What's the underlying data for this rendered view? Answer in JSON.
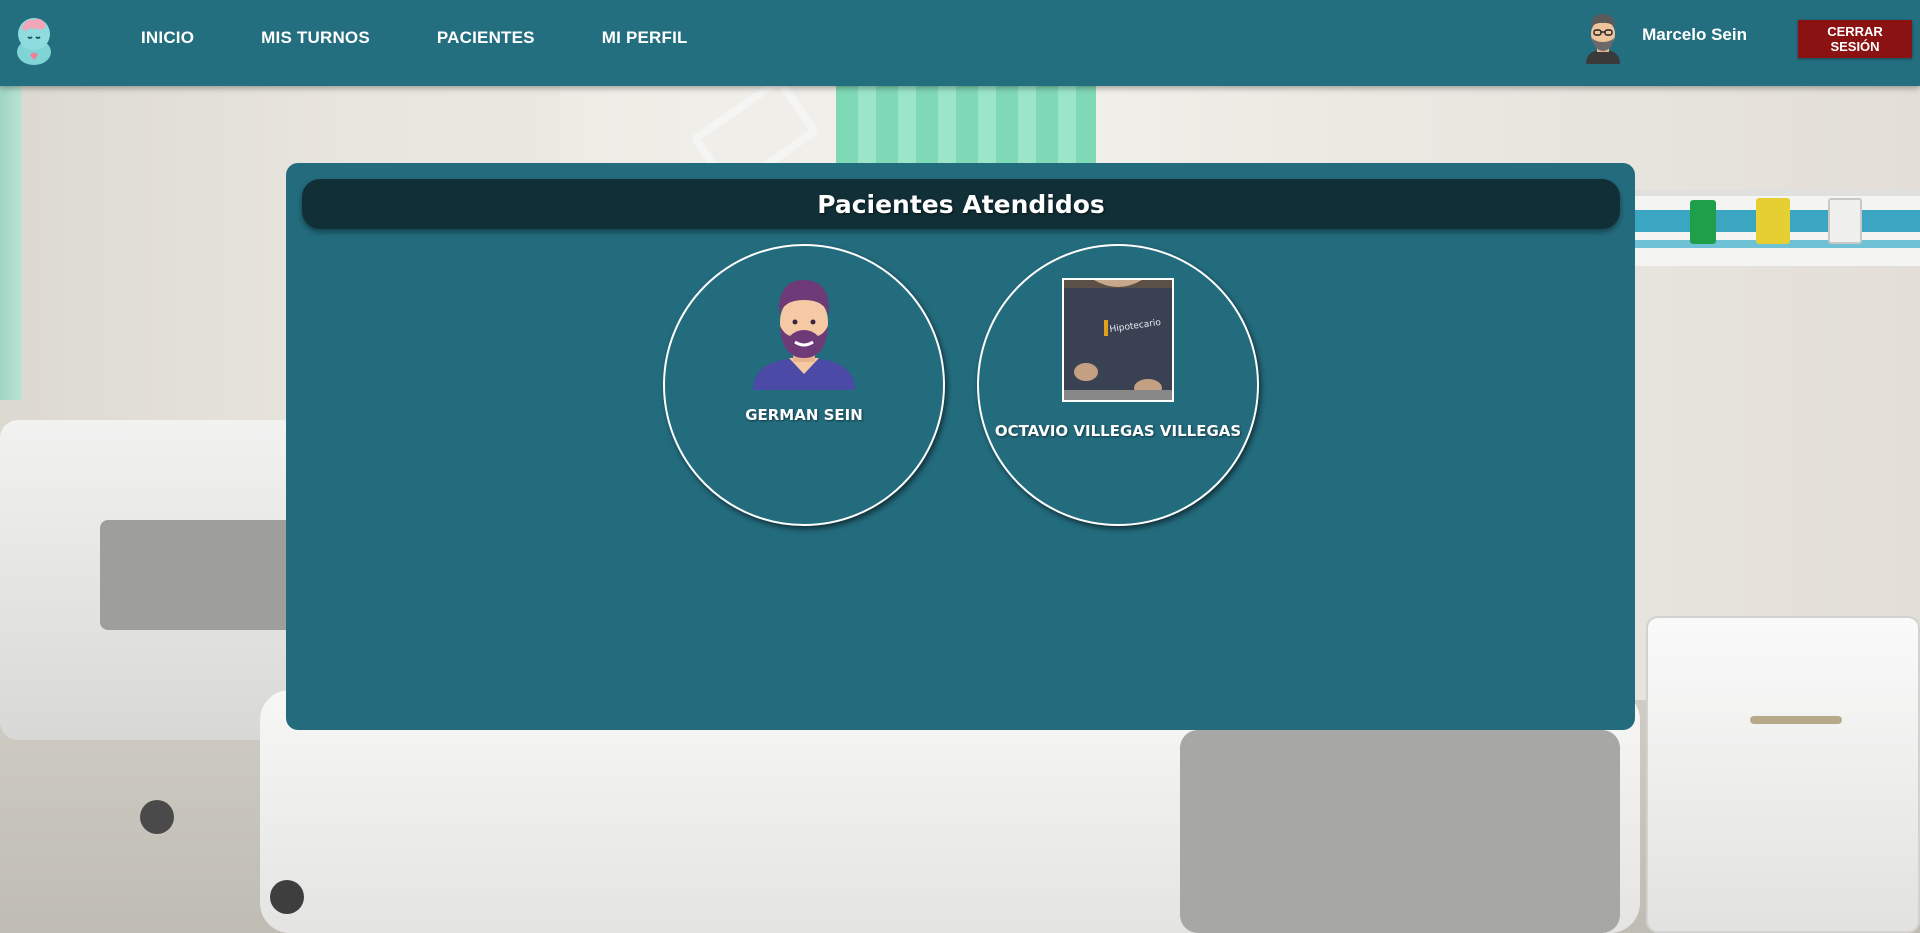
{
  "nav": {
    "links": [
      "INICIO",
      "MIS TURNOS",
      "PACIENTES",
      "MI PERFIL"
    ]
  },
  "user": {
    "name": "Marcelo Sein",
    "logout_label": "CERRAR SESIÓN"
  },
  "panel": {
    "title": "Pacientes Atendidos",
    "patients": [
      {
        "name": "GERMAN SEIN",
        "avatar": "bearded-man-avatar-icon"
      },
      {
        "name": "OCTAVIO VILLEGAS VILLEGAS",
        "avatar": "patient-photo",
        "photo_text": "Hipotecario"
      }
    ]
  },
  "colors": {
    "navbar": "#236f80",
    "panel": "#236c7e",
    "panel_header": "#112f37",
    "logout": "#8b1212"
  }
}
